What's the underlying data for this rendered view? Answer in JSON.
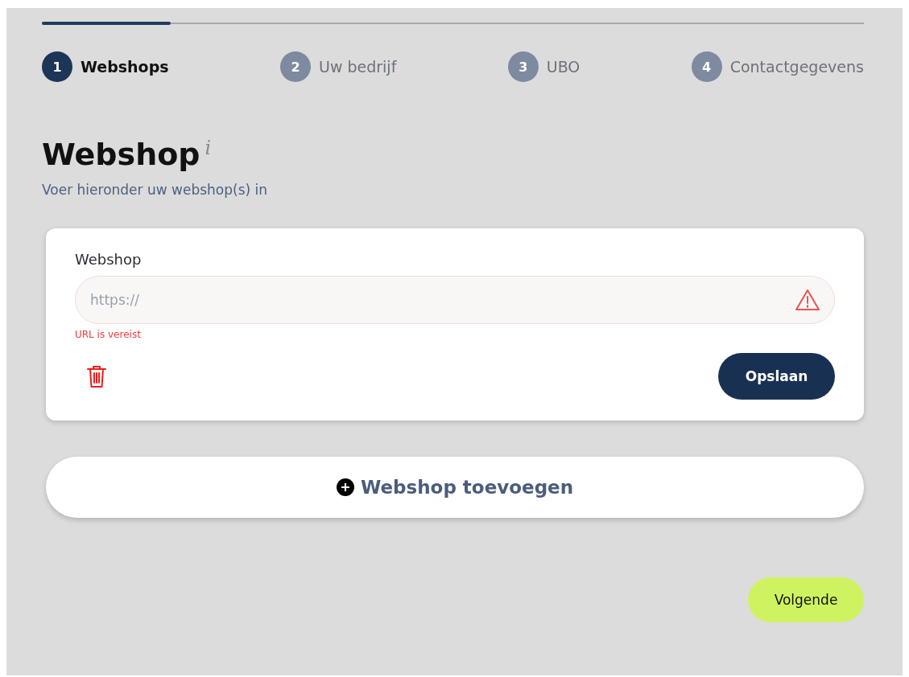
{
  "progress": {
    "level": 0.157
  },
  "steps": [
    {
      "number": "1",
      "label": "Webshops",
      "selected": true
    },
    {
      "number": "2",
      "label": "Uw bedrijf",
      "selected": false
    },
    {
      "number": "3",
      "label": "UBO",
      "selected": false
    },
    {
      "number": "4",
      "label": "Contactgegevens",
      "selected": false
    }
  ],
  "heading": {
    "title": "Webshop",
    "info": "i",
    "subtitle": "Voer hieronder uw webshop(s) in"
  },
  "webshop_card": {
    "label": "Webshop",
    "placeholder": "https://",
    "invalid": true,
    "error": "URL is vereist",
    "save_button": "Opslaan"
  },
  "add_button": "Webshop toevoegen",
  "next_button": "Volgende"
}
